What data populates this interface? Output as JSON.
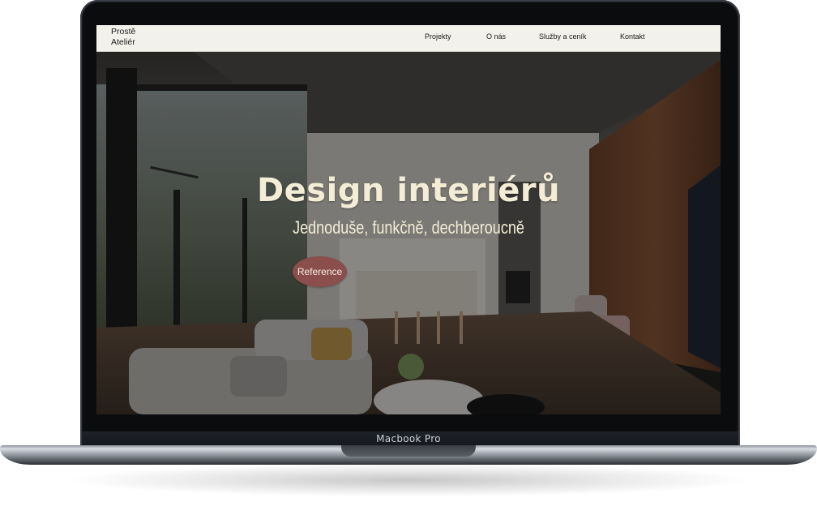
{
  "device": {
    "label": "Macbook Pro"
  },
  "site": {
    "logo": "Prostě Ateliér",
    "nav": {
      "items": [
        {
          "label": "Projekty"
        },
        {
          "label": "O nás"
        },
        {
          "label": "Služby a ceník"
        },
        {
          "label": "Kontakt"
        }
      ]
    },
    "hero": {
      "title": "Design interiérů",
      "subtitle": "Jednoduše, funkčně, dechberoucně",
      "button_label": "Reference",
      "accent_color": "#8a4f4c",
      "text_color": "#f3edd6"
    }
  }
}
